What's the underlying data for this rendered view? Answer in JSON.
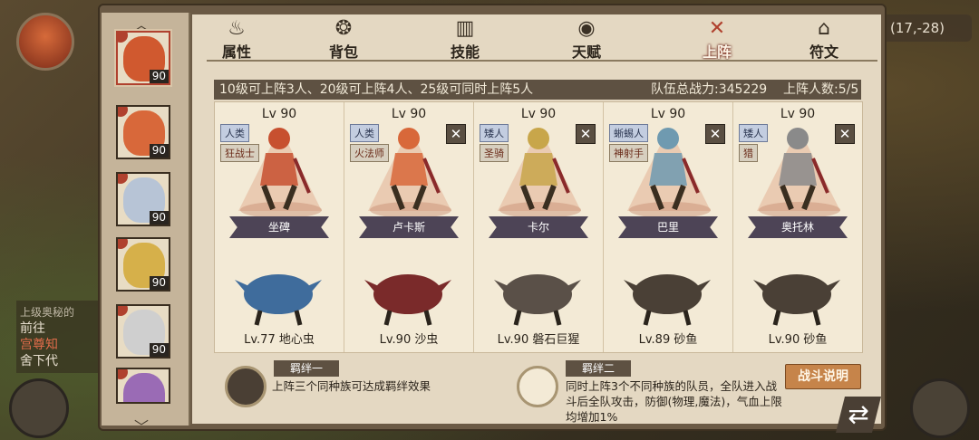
{
  "world": {
    "coords": "(17,-28)",
    "quest_lines": [
      "上级奥秘的",
      "前往",
      "宫尊知",
      "舍下代"
    ]
  },
  "tabs": [
    {
      "label": "属性",
      "icon": "flame-icon"
    },
    {
      "label": "背包",
      "icon": "bag-icon"
    },
    {
      "label": "技能",
      "icon": "book-icon"
    },
    {
      "label": "天赋",
      "icon": "eye-icon"
    },
    {
      "label": "上阵",
      "icon": "crossed-swords-icon",
      "active": true
    },
    {
      "label": "符文",
      "icon": "rune-icon"
    }
  ],
  "roster_bar": {
    "rule_text": "10级可上阵3人、20级可上阵4人、25级可同时上阵5人",
    "power_text": "队伍总战力:345229",
    "count_text": "上阵人数:5/5"
  },
  "side_heroes": [
    {
      "level": "90",
      "color": "#d0592f",
      "selected": true
    },
    {
      "level": "90",
      "color": "#d8683a"
    },
    {
      "level": "90",
      "color": "#b7c4d6"
    },
    {
      "level": "90",
      "color": "#d6b04a"
    },
    {
      "level": "90",
      "color": "#cfcfcf"
    },
    {
      "level": "",
      "color": "#9a6bb5"
    }
  ],
  "slots": [
    {
      "lv": "Lv 90",
      "race": "人类",
      "class": "狂战士",
      "name": "坐碑",
      "pet": "Lv.77 地心虫",
      "hero_color": "#c7502f",
      "pet_color": "#3f6c9c",
      "removable": false
    },
    {
      "lv": "Lv 90",
      "race": "人类",
      "class": "火法师",
      "name": "卢卡斯",
      "pet": "Lv.90 沙虫",
      "hero_color": "#d8683a",
      "pet_color": "#7a2a2a",
      "removable": true
    },
    {
      "lv": "Lv 90",
      "race": "矮人",
      "class": "圣骑",
      "name": "卡尔",
      "pet": "Lv.90 磐石巨猩",
      "hero_color": "#c8a64a",
      "pet_color": "#5a5048",
      "removable": true
    },
    {
      "lv": "Lv 90",
      "race": "蜥蜴人",
      "class": "神射手",
      "name": "巴里",
      "pet": "Lv.89 砂鱼",
      "hero_color": "#6f9ab0",
      "pet_color": "#4a4036",
      "removable": true
    },
    {
      "lv": "Lv 90",
      "race": "矮人",
      "class": "猎",
      "name": "奥托林",
      "pet": "Lv.90 砂鱼",
      "hero_color": "#8a8a8a",
      "pet_color": "#4a4036",
      "removable": true
    }
  ],
  "bonds": [
    {
      "title": "羁绊一",
      "text": "上阵三个同种族可达成羁绊效果"
    },
    {
      "title": "羁绊二",
      "text": "同时上阵3个不同种族的队员，全队进入战斗后全队攻击，防御(物理,魔法)，气血上限均增加1%"
    }
  ],
  "buttons": {
    "battle": "战斗说明"
  },
  "colors": {
    "accent": "#b0412e",
    "panel": "#e4d8c2",
    "dark": "#5e5142"
  }
}
